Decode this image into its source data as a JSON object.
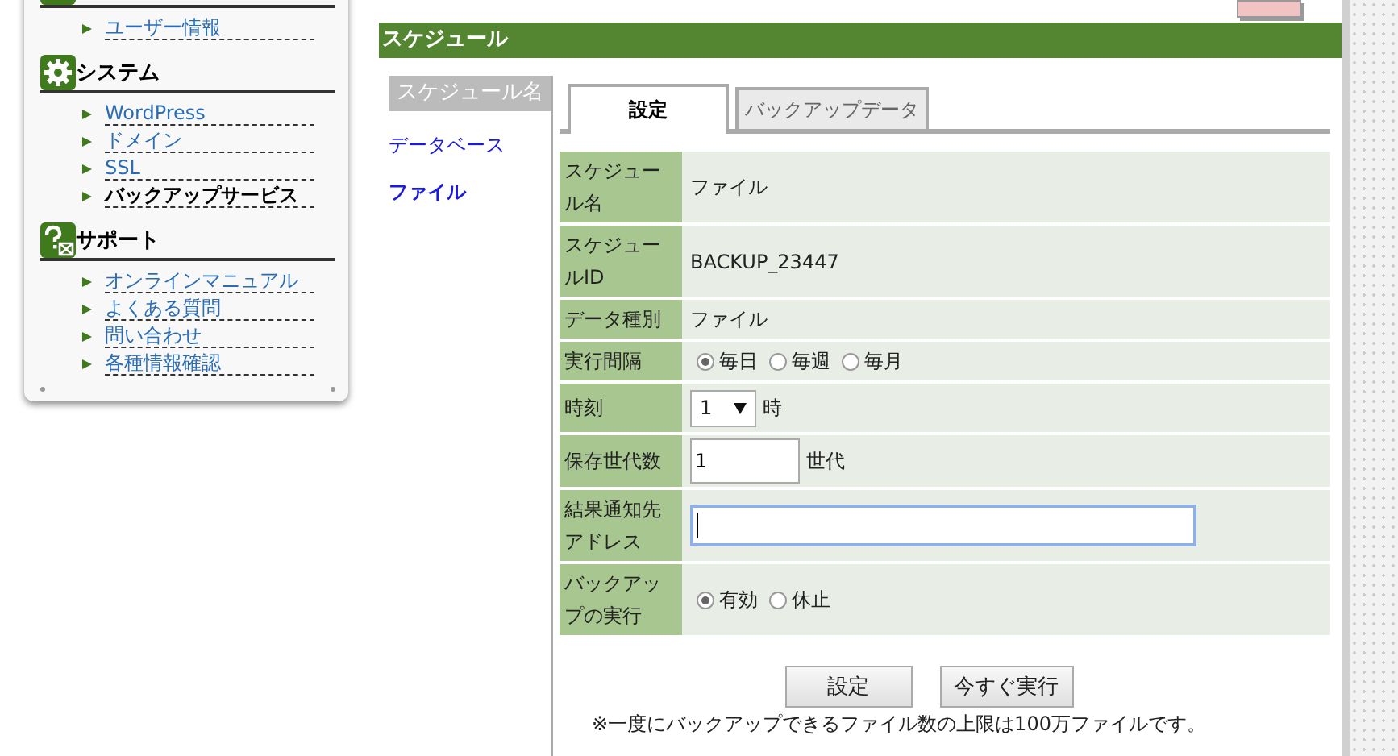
{
  "sidebar": {
    "sections": [
      {
        "items": [
          {
            "label": "ユーザー情報",
            "selected": false
          }
        ]
      },
      {
        "title": "システム",
        "items": [
          {
            "label": "WordPress",
            "selected": false
          },
          {
            "label": "ドメイン",
            "selected": false
          },
          {
            "label": "SSL",
            "selected": false
          },
          {
            "label": "バックアップサービス",
            "selected": true
          }
        ]
      },
      {
        "title": "サポート",
        "items": [
          {
            "label": "オンラインマニュアル",
            "selected": false
          },
          {
            "label": "よくある質問",
            "selected": false
          },
          {
            "label": "問い合わせ",
            "selected": false
          },
          {
            "label": "各種情報確認",
            "selected": false
          }
        ]
      }
    ]
  },
  "header": {
    "title": "スケジュール"
  },
  "subnav": {
    "heading": "スケジュール名",
    "items": [
      {
        "label": "データベース",
        "selected": false
      },
      {
        "label": "ファイル",
        "selected": true
      }
    ]
  },
  "tabs": [
    {
      "label": "設定",
      "selected": true
    },
    {
      "label": "バックアップデータ",
      "selected": false
    }
  ],
  "form": {
    "rows": [
      {
        "kind": "text",
        "label": "スケジュール名",
        "value": "ファイル"
      },
      {
        "kind": "text",
        "label": "スケジュールID",
        "value": "BACKUP_23447"
      },
      {
        "kind": "text",
        "label": "データ種別",
        "value": "ファイル"
      },
      {
        "kind": "radio",
        "label": "実行間隔",
        "options": [
          {
            "label": "毎日",
            "selected": true
          },
          {
            "label": "毎週",
            "selected": false
          },
          {
            "label": "毎月",
            "selected": false
          }
        ]
      },
      {
        "kind": "select",
        "label": "時刻",
        "value": "1",
        "unit": "時"
      },
      {
        "kind": "input",
        "label": "保存世代数",
        "value": "1",
        "unit": "世代"
      },
      {
        "kind": "email",
        "label": "結果通知先アドレス",
        "focused": true
      },
      {
        "kind": "radio",
        "label": "バックアップの実行",
        "options": [
          {
            "label": "有効",
            "selected": true
          },
          {
            "label": "休止",
            "selected": false
          }
        ]
      }
    ]
  },
  "buttons": [
    "設定",
    "今すぐ実行"
  ],
  "note": "※一度にバックアップできるファイル数の上限は100万ファイルです。"
}
